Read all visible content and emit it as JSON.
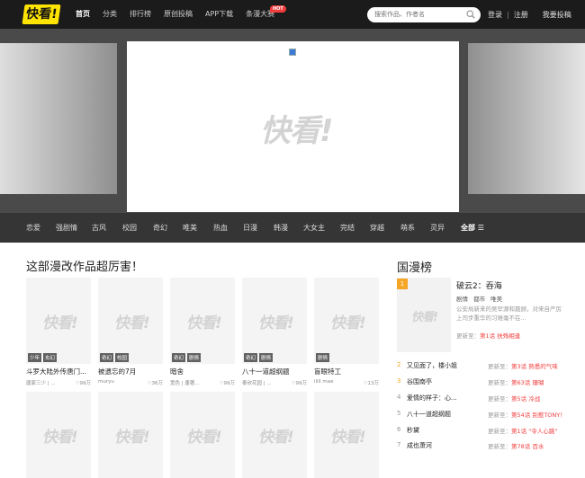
{
  "header": {
    "logo": "快看!",
    "nav": [
      "首页",
      "分类",
      "排行榜",
      "原创投稿",
      "APP下载",
      "条漫大赛"
    ],
    "hot_badge": "HOT",
    "search_placeholder": "搜索作品、作者名",
    "login": "登录",
    "separator": "|",
    "register": "注册",
    "submit": "我要投稿"
  },
  "banner": {
    "watermark": "快看!"
  },
  "categories": [
    "恋爱",
    "强剧情",
    "古风",
    "校园",
    "奇幻",
    "唯美",
    "热血",
    "日漫",
    "韩漫",
    "大女主",
    "完结",
    "穿越",
    "萌系",
    "灵异",
    "全部 ☰"
  ],
  "section": {
    "title": "这部漫改作品超厉害！",
    "watermark": "快看!",
    "cards": [
      {
        "tags": [
          "少年",
          "玄幻"
        ],
        "title": "斗罗大陆外传唐门...",
        "author": "唐家三少 | ...",
        "likes": "99万"
      },
      {
        "tags": [
          "奇幻",
          "校园"
        ],
        "title": "被遗忘的7月",
        "author": "muryu",
        "likes": "36万"
      },
      {
        "tags": [
          "奇幻",
          "剧情"
        ],
        "title": "暗舍",
        "author": "宽色 | 唐著...",
        "likes": "99万"
      },
      {
        "tags": [
          "奇幻",
          "剧情"
        ],
        "title": "八十一道超纲题",
        "author": "泰欣花园 | ...",
        "likes": "99万"
      },
      {
        "tags": [
          "剧情"
        ],
        "title": "盲眼特工",
        "author": "lilll mae",
        "likes": "13万"
      }
    ]
  },
  "ranking": {
    "title": "国漫榜",
    "watermark": "快看!",
    "top": {
      "rank": "1",
      "title": "破云2：吞海",
      "genres": [
        "剧情",
        "都市",
        "唯美"
      ],
      "desc": "公安局新来的吴罕源和聂顾，对来自严厉上司步重华的习难毫不在...",
      "update_prefix": "更新至：",
      "update": "第1话 扶殇相逢"
    },
    "items": [
      {
        "rank": "2",
        "title": "又见面了，楼小姐",
        "update_prefix": "更新至：",
        "update": "第3话 熟悉的气味"
      },
      {
        "rank": "3",
        "title": "谷围南亭",
        "update_prefix": "更新至：",
        "update": "第63话 珊瑚"
      },
      {
        "rank": "4",
        "title": "爱情的样子：心...",
        "update_prefix": "更新至：",
        "update": "第5话 冷战"
      },
      {
        "rank": "5",
        "title": "八十一道超纲题",
        "update_prefix": "更新至：",
        "update": "第54话 别惹TONY！"
      },
      {
        "rank": "6",
        "title": "秒黛",
        "update_prefix": "更新至：",
        "update": "第1话 \"令人心跳\""
      },
      {
        "rank": "7",
        "title": "成也萧河",
        "update_prefix": "更新至：",
        "update": "第78话 百水"
      }
    ]
  },
  "colors": {
    "topbar": "#1b1b1b",
    "logo": "#ffe400",
    "catbar": "#353535",
    "accent": "#f23b3b",
    "rank_highlight": "#f5a623"
  }
}
